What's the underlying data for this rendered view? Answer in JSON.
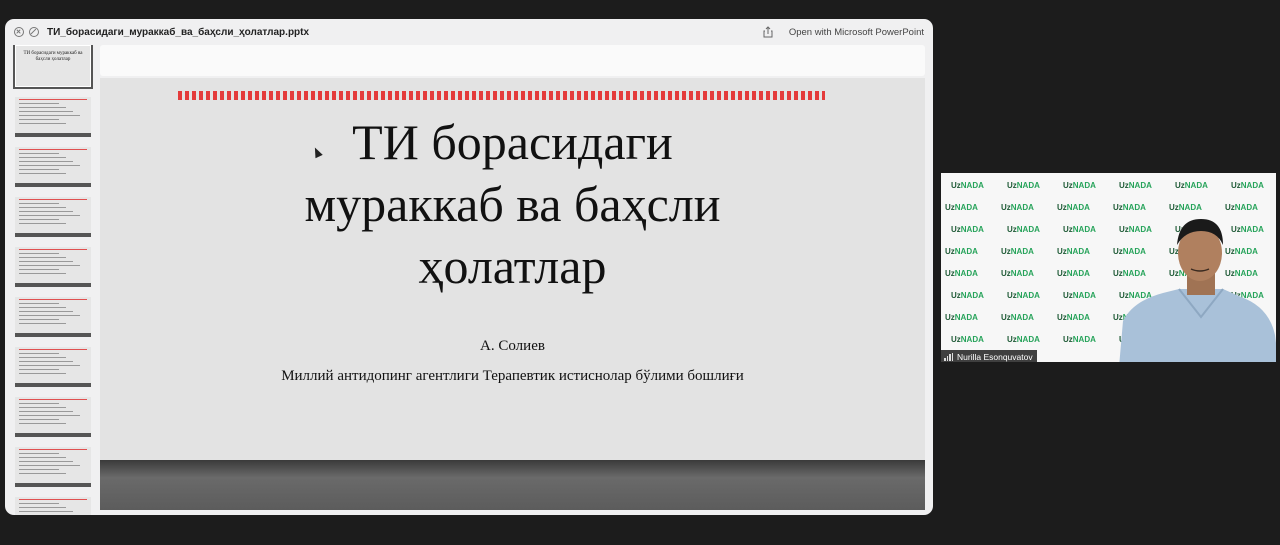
{
  "window": {
    "filename": "ТИ_борасидаги_мураккаб_ва_баҳсли_ҳолатлар.pptx",
    "open_label": "Open with Microsoft PowerPoint"
  },
  "thumbnails": [
    {
      "title": "ТИ борасидаги мураккаб ва баҳсли ҳолатлар"
    },
    {
      "title": ""
    },
    {
      "title": ""
    },
    {
      "title": ""
    },
    {
      "title": ""
    },
    {
      "title": ""
    },
    {
      "title": ""
    },
    {
      "title": ""
    },
    {
      "title": ""
    },
    {
      "title": ""
    }
  ],
  "slide": {
    "title_line1": "ТИ борасидаги",
    "title_line2": "мураккаб ва баҳсли",
    "title_line3": "ҳолатлар",
    "author": "А. Солиев",
    "role": "Миллий антидопинг агентлиги Терапевтик истиснолар бўлими бошлиғи"
  },
  "video": {
    "participant_name": "Nurilla Esonquvatov",
    "logo_text_main": "Uz",
    "logo_text_brand": "NADA"
  },
  "colors": {
    "accent_stripe": "#e43b3b",
    "logo_green": "#26a35a"
  }
}
